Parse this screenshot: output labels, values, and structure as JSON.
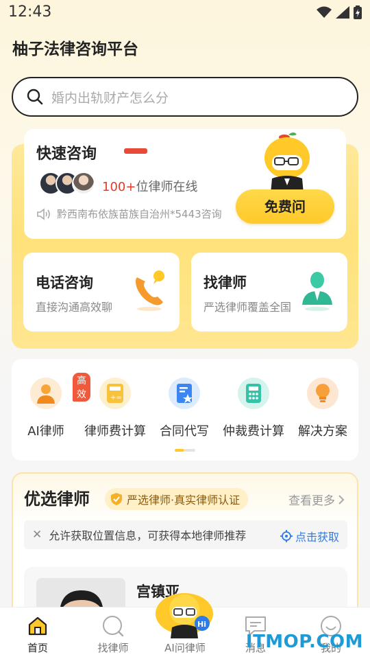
{
  "status_bar": {
    "time": "12:43"
  },
  "app": {
    "title": "柚子法律咨询平台"
  },
  "search": {
    "placeholder": "婚内出轨财产怎么分"
  },
  "quick_consult": {
    "title": "快速咨询",
    "online_count": "100+",
    "online_suffix": "位律师在线",
    "ticker": "黔西南布依族苗族自治州*5443咨询",
    "free_button": "免费问"
  },
  "services": [
    {
      "title": "电话咨询",
      "subtitle": "直接沟通高效聊"
    },
    {
      "title": "找律师",
      "subtitle": "严选律师覆盖全国"
    }
  ],
  "tools": [
    {
      "label": "AI律师",
      "badge": "高效",
      "icon": "ai-lawyer-icon"
    },
    {
      "label": "律师费计算",
      "icon": "calculator-icon"
    },
    {
      "label": "合同代写",
      "icon": "contract-icon"
    },
    {
      "label": "仲裁费计算",
      "icon": "arbitration-calculator-icon"
    },
    {
      "label": "解决方案",
      "icon": "lightbulb-icon"
    }
  ],
  "lawyers": {
    "title": "优选律师",
    "verify": "严选律师·真实律师认证",
    "more": "查看更多",
    "location_tip": "允许获取位置信息，可获得本地律师推荐",
    "location_action": "点击获取",
    "first_lawyer": {
      "name": "宫镇亚"
    }
  },
  "tabbar": [
    {
      "label": "首页",
      "icon": "home-icon",
      "active": true
    },
    {
      "label": "找律师",
      "icon": "search-lawyer-icon"
    },
    {
      "label": "AI问律师",
      "icon": "ai-mascot-icon"
    },
    {
      "label": "消息",
      "icon": "message-icon"
    },
    {
      "label": "我的",
      "icon": "profile-icon"
    }
  ],
  "watermark": "ITMOP.COM",
  "colors": {
    "accent": "#ffc92a",
    "link": "#2e7be6",
    "hot": "#e5392b"
  }
}
